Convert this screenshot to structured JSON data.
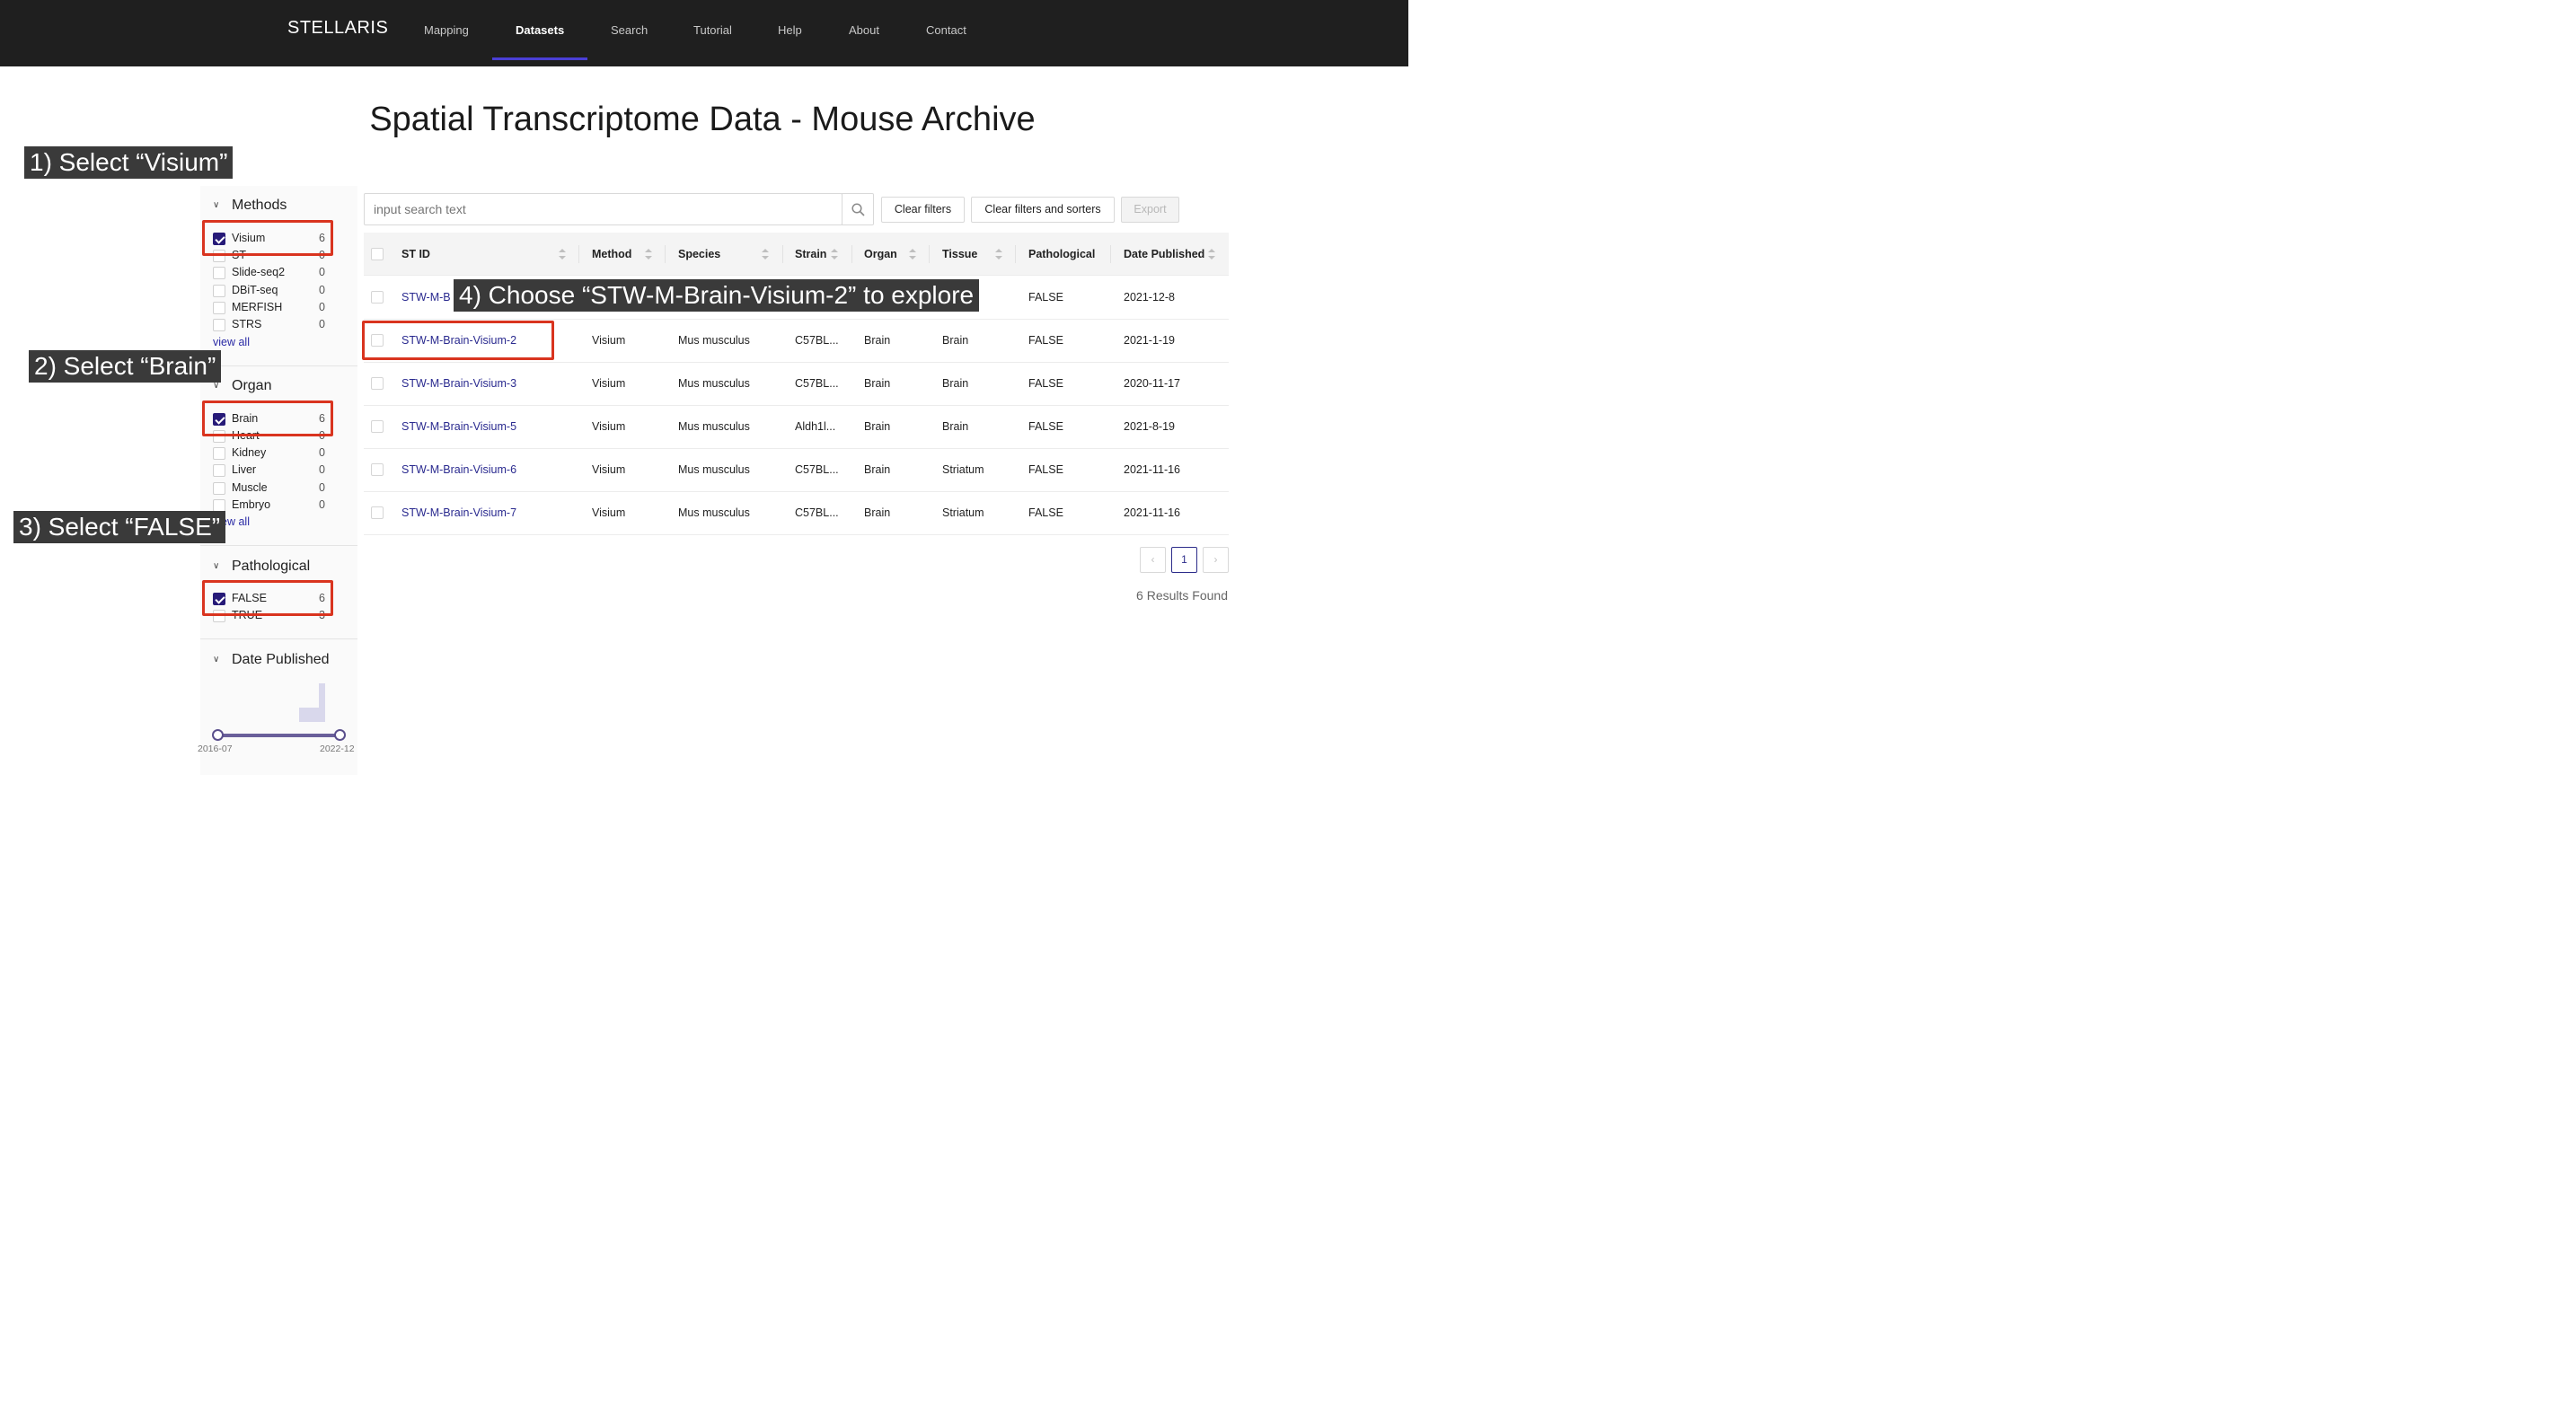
{
  "nav": {
    "brand": "STELLARIS",
    "items": [
      "Mapping",
      "Datasets",
      "Search",
      "Tutorial",
      "Help",
      "About",
      "Contact"
    ],
    "active": "Datasets"
  },
  "page_title": "Spatial Transcriptome Data - Mouse Archive",
  "filters": {
    "methods": {
      "title": "Methods",
      "options": [
        {
          "label": "Visium",
          "count": "6",
          "checked": true
        },
        {
          "label": "ST",
          "count": "0",
          "checked": false
        },
        {
          "label": "Slide-seq2",
          "count": "0",
          "checked": false
        },
        {
          "label": "DBiT-seq",
          "count": "0",
          "checked": false
        },
        {
          "label": "MERFISH",
          "count": "0",
          "checked": false
        },
        {
          "label": "STRS",
          "count": "0",
          "checked": false
        }
      ],
      "view_all": "view all"
    },
    "organ": {
      "title": "Organ",
      "options": [
        {
          "label": "Brain",
          "count": "6",
          "checked": true
        },
        {
          "label": "Heart",
          "count": "0",
          "checked": false
        },
        {
          "label": "Kidney",
          "count": "0",
          "checked": false
        },
        {
          "label": "Liver",
          "count": "0",
          "checked": false
        },
        {
          "label": "Muscle",
          "count": "0",
          "checked": false
        },
        {
          "label": "Embryo",
          "count": "0",
          "checked": false
        }
      ],
      "view_all": "view all"
    },
    "pathological": {
      "title": "Pathological",
      "options": [
        {
          "label": "FALSE",
          "count": "6",
          "checked": true
        },
        {
          "label": "TRUE",
          "count": "3",
          "checked": false
        }
      ]
    },
    "date_published": {
      "title": "Date Published",
      "range_start": "2016-07",
      "range_end": "2022-12"
    }
  },
  "toolbar": {
    "search_placeholder": "input search text",
    "clear_filters": "Clear filters",
    "clear_filters_sorters": "Clear filters and sorters",
    "export": "Export"
  },
  "table": {
    "columns": [
      "ST ID",
      "Method",
      "Species",
      "Strain",
      "Organ",
      "Tissue",
      "Pathological",
      "Date Published"
    ],
    "rows": [
      {
        "st_id": "STW-M-B",
        "method": "",
        "species": "",
        "strain": "",
        "organ": "",
        "tissue": "",
        "pathological": "FALSE",
        "date": "2021-12-8"
      },
      {
        "st_id": "STW-M-Brain-Visium-2",
        "method": "Visium",
        "species": "Mus musculus",
        "strain": "C57BL...",
        "organ": "Brain",
        "tissue": "Brain",
        "pathological": "FALSE",
        "date": "2021-1-19"
      },
      {
        "st_id": "STW-M-Brain-Visium-3",
        "method": "Visium",
        "species": "Mus musculus",
        "strain": "C57BL...",
        "organ": "Brain",
        "tissue": "Brain",
        "pathological": "FALSE",
        "date": "2020-11-17"
      },
      {
        "st_id": "STW-M-Brain-Visium-5",
        "method": "Visium",
        "species": "Mus musculus",
        "strain": "Aldh1l...",
        "organ": "Brain",
        "tissue": "Brain",
        "pathological": "FALSE",
        "date": "2021-8-19"
      },
      {
        "st_id": "STW-M-Brain-Visium-6",
        "method": "Visium",
        "species": "Mus musculus",
        "strain": "C57BL...",
        "organ": "Brain",
        "tissue": "Striatum",
        "pathological": "FALSE",
        "date": "2021-11-16"
      },
      {
        "st_id": "STW-M-Brain-Visium-7",
        "method": "Visium",
        "species": "Mus musculus",
        "strain": "C57BL...",
        "organ": "Brain",
        "tissue": "Striatum",
        "pathological": "FALSE",
        "date": "2021-11-16"
      }
    ]
  },
  "pagination": {
    "prev": "‹",
    "current": "1",
    "next": "›"
  },
  "results_text": "6 Results Found",
  "annotations": {
    "step1": "1) Select “Visium”",
    "step2": "2) Select “Brain”",
    "step3": "3) Select “FALSE”",
    "step4": "4) Choose “STW-M-Brain-Visium-2” to explore"
  },
  "colors": {
    "nav_bg": "#1f1f1f",
    "accent": "#261a78",
    "link": "#2a2a8f",
    "annotation_box": "#d9341f"
  }
}
